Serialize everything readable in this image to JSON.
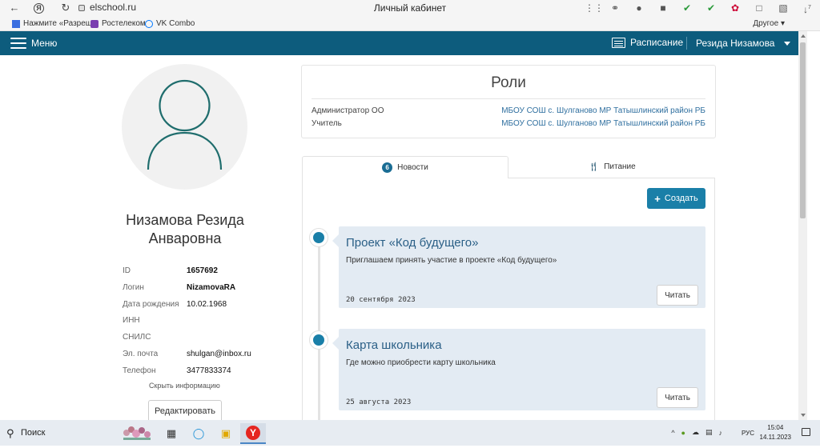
{
  "browser": {
    "address": "elschool.ru",
    "window_title": "Личный кабинет",
    "bookmarks": [
      {
        "label": "Нажмите «Разреш",
        "color": "#3a6ee0"
      },
      {
        "label": "Ростелеком",
        "color": "#7a3fb0"
      },
      {
        "label": "VK Combo",
        "color": "#0077ff"
      }
    ],
    "other_bookmarks": "Другое",
    "downloads_count": "7"
  },
  "header": {
    "menu_label": "Меню",
    "schedule_label": "Расписание",
    "user_name": "Резида Низамова",
    "bg_color": "#0d5c7d"
  },
  "profile": {
    "full_name": "Низамова Резида Анваровна",
    "fields": [
      {
        "label": "ID",
        "value": "1657692",
        "bold": true
      },
      {
        "label": "Логин",
        "value": "NizamovaRA",
        "bold": true
      },
      {
        "label": "Дата рождения",
        "value": "10.02.1968",
        "bold": false
      },
      {
        "label": "ИНН",
        "value": "",
        "bold": false
      },
      {
        "label": "СНИЛС",
        "value": "",
        "bold": false
      },
      {
        "label": "Эл. почта",
        "value": "shulgan@inbox.ru",
        "bold": false
      },
      {
        "label": "Телефон",
        "value": "3477833374",
        "bold": false
      }
    ],
    "hide_info_label": "Скрыть информацию",
    "edit_label": "Редактировать"
  },
  "roles": {
    "title": "Роли",
    "items": [
      {
        "role": "Администратор ОО",
        "org": "МБОУ СОШ с. Шулганово МР Татышлинский район РБ"
      },
      {
        "role": "Учитель",
        "org": "МБОУ СОШ с. Шулганово МР Татышлинский район РБ"
      }
    ]
  },
  "tabs": {
    "news_label": "Новости",
    "news_count": "6",
    "food_label": "Питание"
  },
  "create_label": "Создать",
  "news": [
    {
      "title": "Проект «Код будущего»",
      "description": "Приглашаем принять участие в проекте «Код будущего»",
      "date": "20 сентября 2023",
      "read_label": "Читать"
    },
    {
      "title": "Карта школьника",
      "description": "Где можно приобрести карту школьника",
      "date": "25 августа 2023",
      "read_label": "Читать"
    }
  ],
  "taskbar": {
    "search_label": "Поиск",
    "language": "РУС",
    "time": "15:04",
    "date": "14.11.2023"
  }
}
